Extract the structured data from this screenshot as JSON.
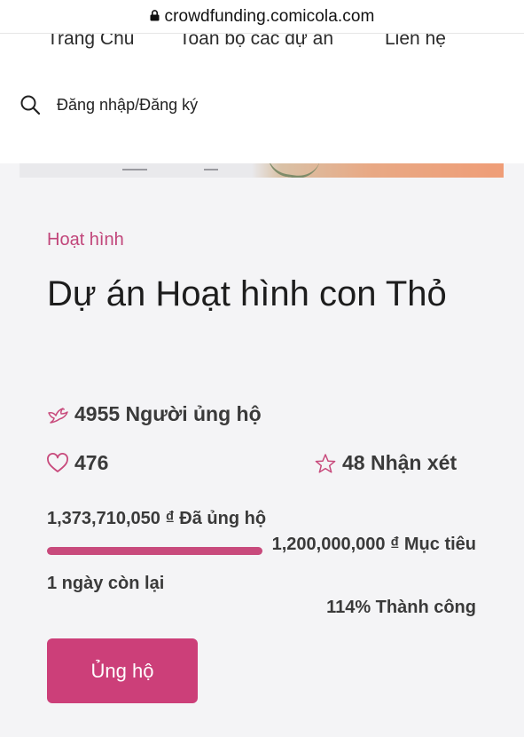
{
  "browser": {
    "url": "crowdfunding.comicola.com"
  },
  "nav": {
    "links": [
      "Trang Chủ",
      "Toàn bộ các dự án",
      "Liên hệ"
    ],
    "login_label": "Đăng nhập/Đăng ký"
  },
  "project": {
    "category": "Hoạt hình",
    "title": "Dự án Hoạt hình con Thỏ",
    "supporters": "4955 Người ủng hộ",
    "likes": "476",
    "reviews": "48 Nhận xét",
    "funded": "1,373,710,050 ₫ Đã ủng hộ",
    "goal": "1,200,000,000 ₫ Mục tiêu",
    "days_left": "1 ngày còn lại",
    "success": "114% Thành công",
    "progress_fraction": 1.0,
    "support_button": "Ủng hộ"
  },
  "colors": {
    "accent": "#cc3f79",
    "category": "#c1457a",
    "page_bg": "#f4f4f6"
  }
}
